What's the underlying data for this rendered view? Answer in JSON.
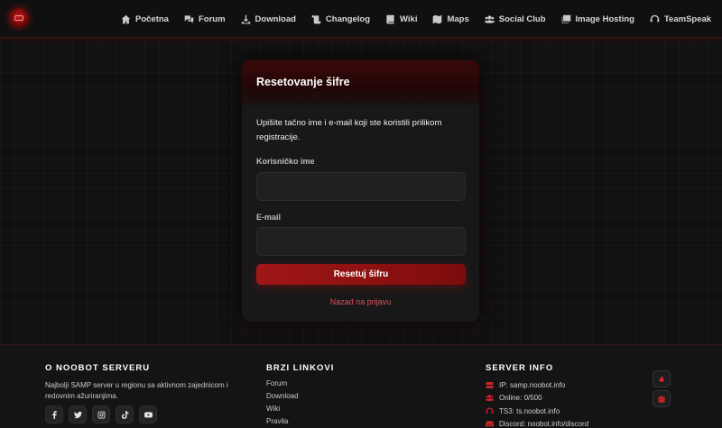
{
  "nav": {
    "items": [
      {
        "label": "Početna",
        "icon": "home-icon"
      },
      {
        "label": "Forum",
        "icon": "comments-icon"
      },
      {
        "label": "Download",
        "icon": "download-icon"
      },
      {
        "label": "Changelog",
        "icon": "scroll-icon"
      },
      {
        "label": "Wiki",
        "icon": "book-icon"
      },
      {
        "label": "Maps",
        "icon": "map-icon"
      },
      {
        "label": "Social Club",
        "icon": "users-icon"
      },
      {
        "label": "Image Hosting",
        "icon": "images-icon"
      },
      {
        "label": "TeamSpeak",
        "icon": "headset-icon"
      }
    ]
  },
  "card": {
    "title": "Resetovanje šifre",
    "description": "Upišite tačno ime i e-mail koji ste koristili prilikom registracije.",
    "username_label": "Korisničko ime",
    "username_value": "",
    "email_label": "E-mail",
    "email_value": "",
    "submit_label": "Resetuj šifru",
    "back_link": "Nazad na prijavu"
  },
  "footer": {
    "about": {
      "heading": "O NOOBOT SERVERU",
      "text": "Najbolji SAMP server u regionu sa aktivnom zajednicom i redovnim ažuriranjima.",
      "socials": [
        "facebook-icon",
        "twitter-icon",
        "instagram-icon",
        "tiktok-icon",
        "youtube-icon"
      ]
    },
    "links": {
      "heading": "BRZI LINKOVI",
      "items": [
        "Forum",
        "Download",
        "Wiki",
        "Pravila"
      ]
    },
    "server": {
      "heading": "SERVER INFO",
      "rows": [
        {
          "icon": "server-icon",
          "text": "IP: samp.noobot.info"
        },
        {
          "icon": "users-icon",
          "text": "Online: 0/500"
        },
        {
          "icon": "headset-icon",
          "text": "TS3: ts.noobot.info"
        },
        {
          "icon": "discord-icon",
          "text": "Discord: noobot.info/discord"
        }
      ]
    }
  },
  "colors": {
    "accent": "#a11717",
    "link": "#e0505a",
    "background": "#111112"
  }
}
